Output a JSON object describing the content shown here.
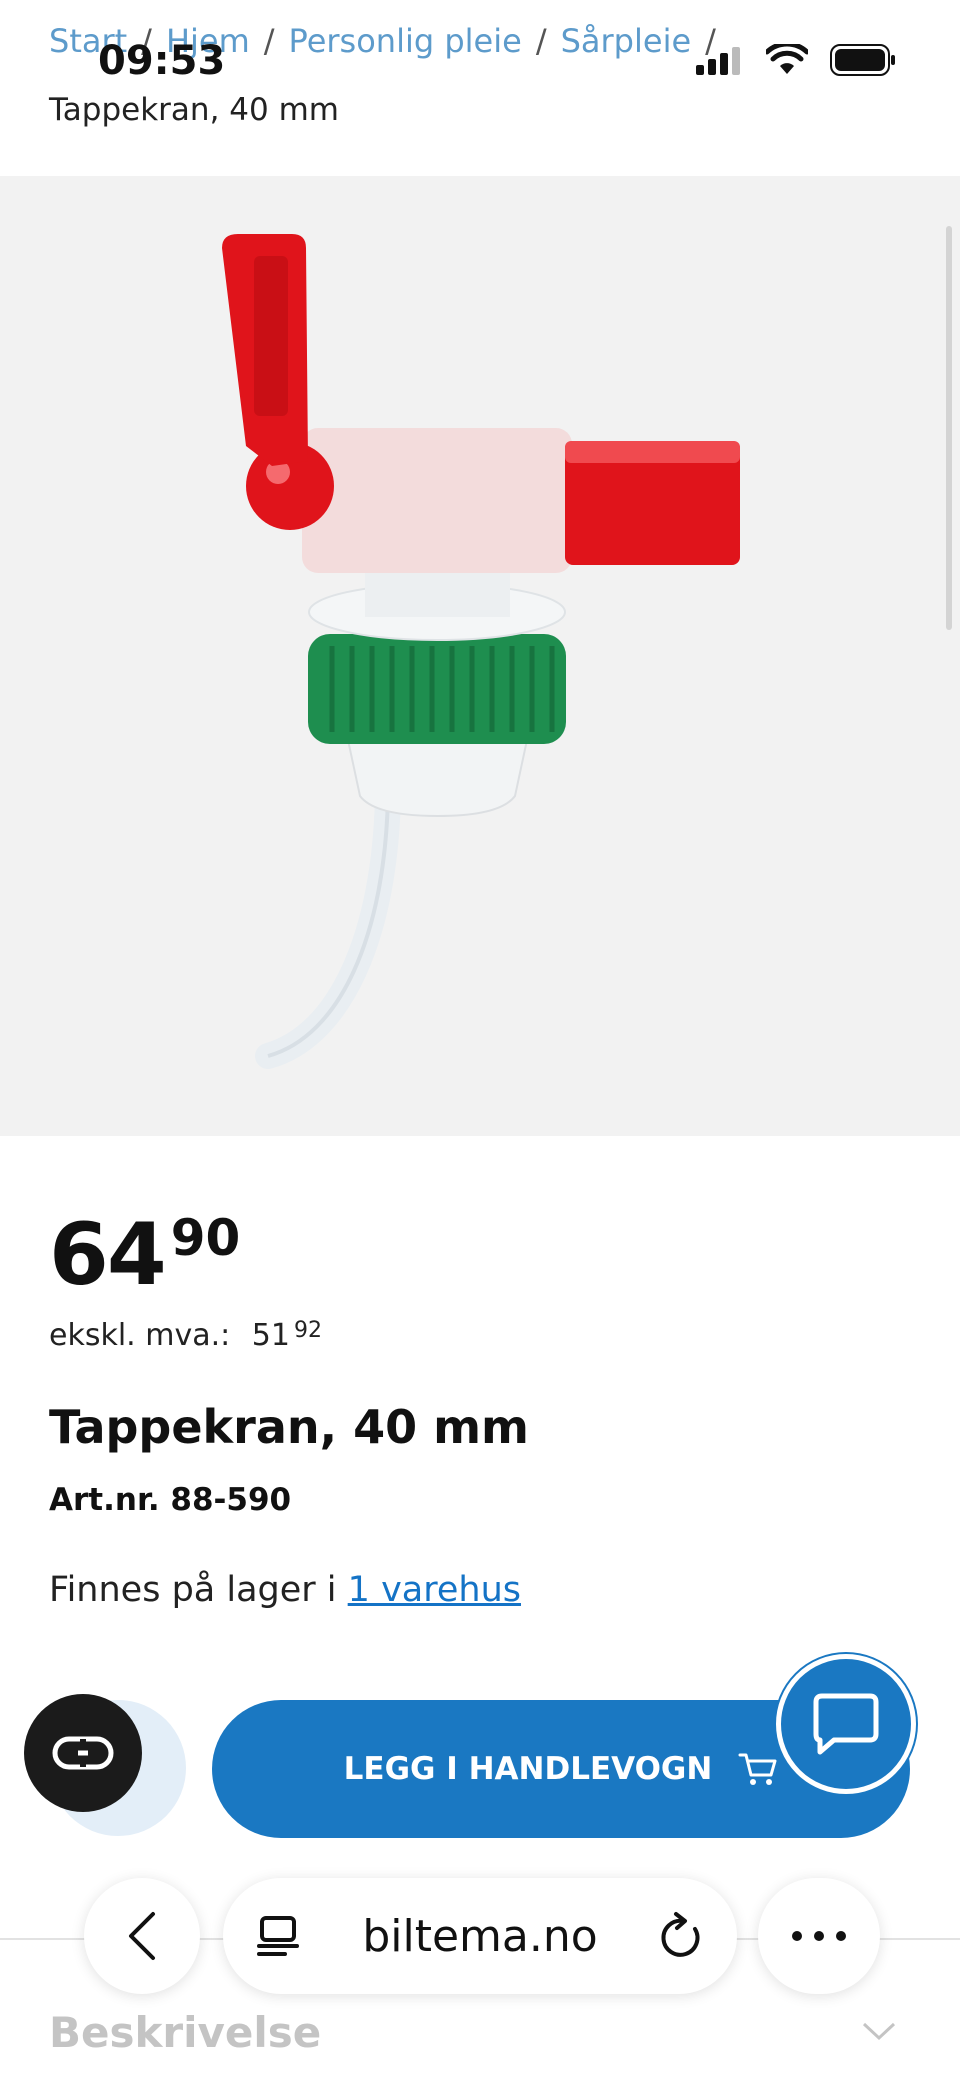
{
  "status": {
    "time": "09:53"
  },
  "breadcrumb": {
    "items": [
      "Start",
      "Hjem",
      "Personlig pleie",
      "Sårpleie"
    ],
    "current": "Tappekran, 40 mm"
  },
  "product": {
    "price_int": "64",
    "price_dec": "90",
    "ex_vat_label": "ekskl. mva.:",
    "ex_vat_int": "51",
    "ex_vat_dec": "92",
    "title": "Tappekran, 40 mm",
    "artnr": "Art.nr. 88-590",
    "stock_prefix": "Finnes på lager i",
    "stock_link": "1 varehus"
  },
  "actions": {
    "cart_label": "LEGG I HANDLEVOGN"
  },
  "sections": {
    "description": "Beskrivelse"
  },
  "browser": {
    "url": "biltema.no"
  },
  "colors": {
    "accent": "#1a78c2",
    "link": "#1473c6",
    "breadcrumb": "#5d9bcb"
  }
}
